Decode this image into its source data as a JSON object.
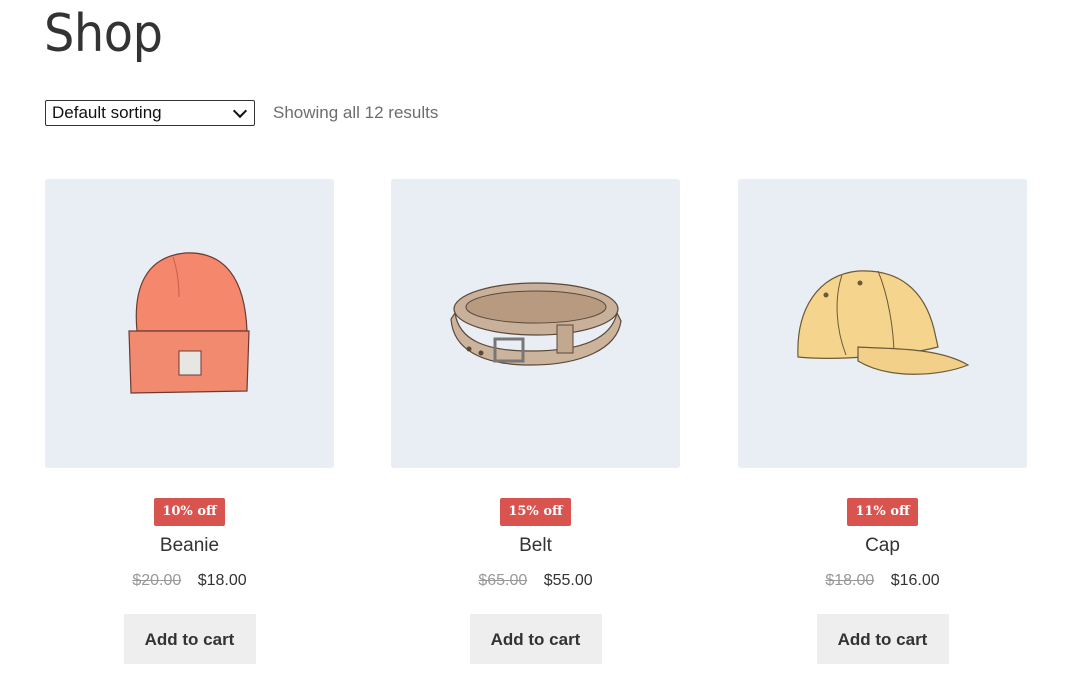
{
  "page": {
    "title": "Shop"
  },
  "toolbar": {
    "sort_selected": "Default sorting",
    "result_count": "Showing all 12 results"
  },
  "products": [
    {
      "name": "Beanie",
      "badge": "10% off",
      "old_price": "$20.00",
      "new_price": "$18.00",
      "button": "Add to cart",
      "image_icon": "beanie-image"
    },
    {
      "name": "Belt",
      "badge": "15% off",
      "old_price": "$65.00",
      "new_price": "$55.00",
      "button": "Add to cart",
      "image_icon": "belt-image"
    },
    {
      "name": "Cap",
      "badge": "11% off",
      "old_price": "$18.00",
      "new_price": "$16.00",
      "button": "Add to cart",
      "image_icon": "cap-image"
    }
  ],
  "colors": {
    "badge": "#d9534f",
    "image_bg": "#e8eef3",
    "button_bg": "#eeeeee"
  }
}
